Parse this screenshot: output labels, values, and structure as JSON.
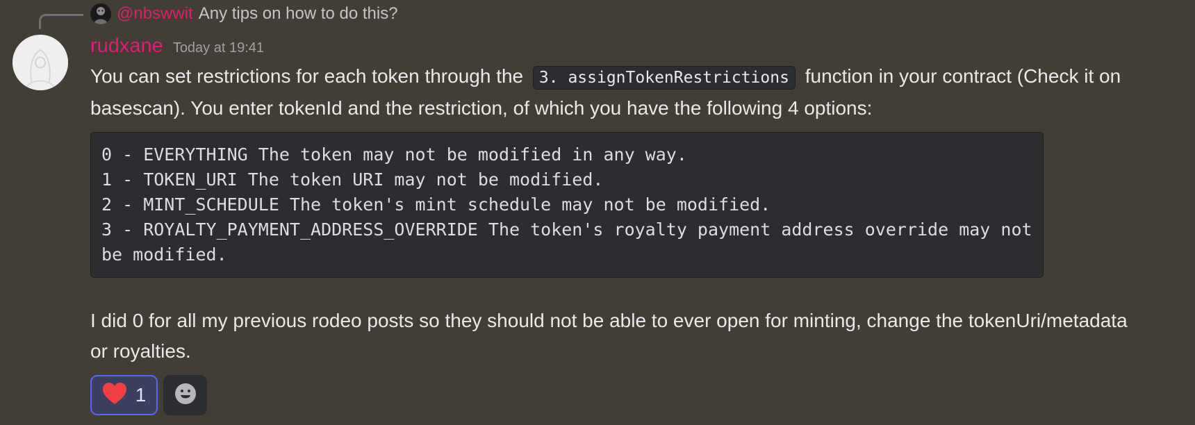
{
  "reply": {
    "mention": "@nbswwit",
    "text": "Any tips on how to do this?"
  },
  "message": {
    "username": "rudxane",
    "timestamp": "Today at 19:41",
    "paragraph1_before": "You can set restrictions for each token through the",
    "inline_code": "3. assignTokenRestrictions",
    "paragraph1_after": "function in your contract (Check it on basescan). You enter tokenId and the restriction, of which you have the following 4 options:",
    "code_lines": [
      "0 - EVERYTHING The token may not be modified in any way.",
      "1 - TOKEN_URI The token URI may not be modified.",
      "2 - MINT_SCHEDULE The token's mint schedule may not be modified.",
      "3 - ROYALTY_PAYMENT_ADDRESS_OVERRIDE The token's royalty payment address override may not be modified."
    ],
    "paragraph2": "I did 0 for all my previous rodeo posts so they should not be able to ever open for minting, change the tokenUri/metadata or royalties."
  },
  "reactions": [
    {
      "icon": "heart-icon",
      "count": "1",
      "color": "#f23f43"
    }
  ],
  "add_reaction_icon": "add-reaction-icon",
  "colors": {
    "background": "#423e35",
    "username": "#df1c76",
    "mention": "#d6216b",
    "codeblock_bg": "#2b2d31",
    "reaction_border": "#5865f2"
  }
}
